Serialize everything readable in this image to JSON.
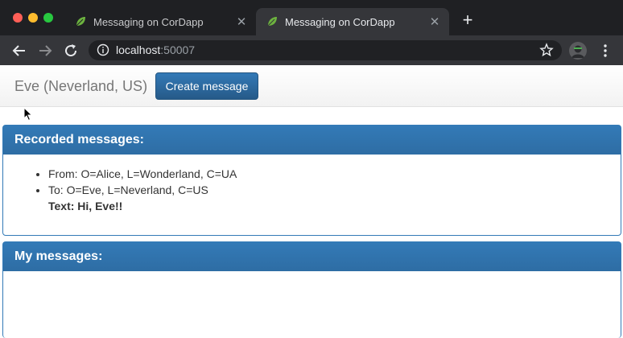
{
  "browser": {
    "tabs": [
      {
        "title": "Messaging on CorDapp",
        "active": false
      },
      {
        "title": "Messaging on CorDapp",
        "active": true
      }
    ],
    "new_tab_icon": "plus-icon",
    "url_host": "localhost",
    "url_port": ":50007"
  },
  "navbar": {
    "brand": "Eve (Neverland, US)",
    "create_button_label": "Create message"
  },
  "recorded": {
    "heading": "Recorded messages:",
    "from": "From: O=Alice, L=Wonderland, C=UA",
    "to": "To: O=Eve, L=Neverland, C=US",
    "text": "Text: Hi, Eve!!"
  },
  "mine": {
    "heading": "My messages:"
  },
  "colors": {
    "primary": "#337ab7",
    "chrome_dark": "#1f2023",
    "chrome_toolbar": "#35363a"
  }
}
